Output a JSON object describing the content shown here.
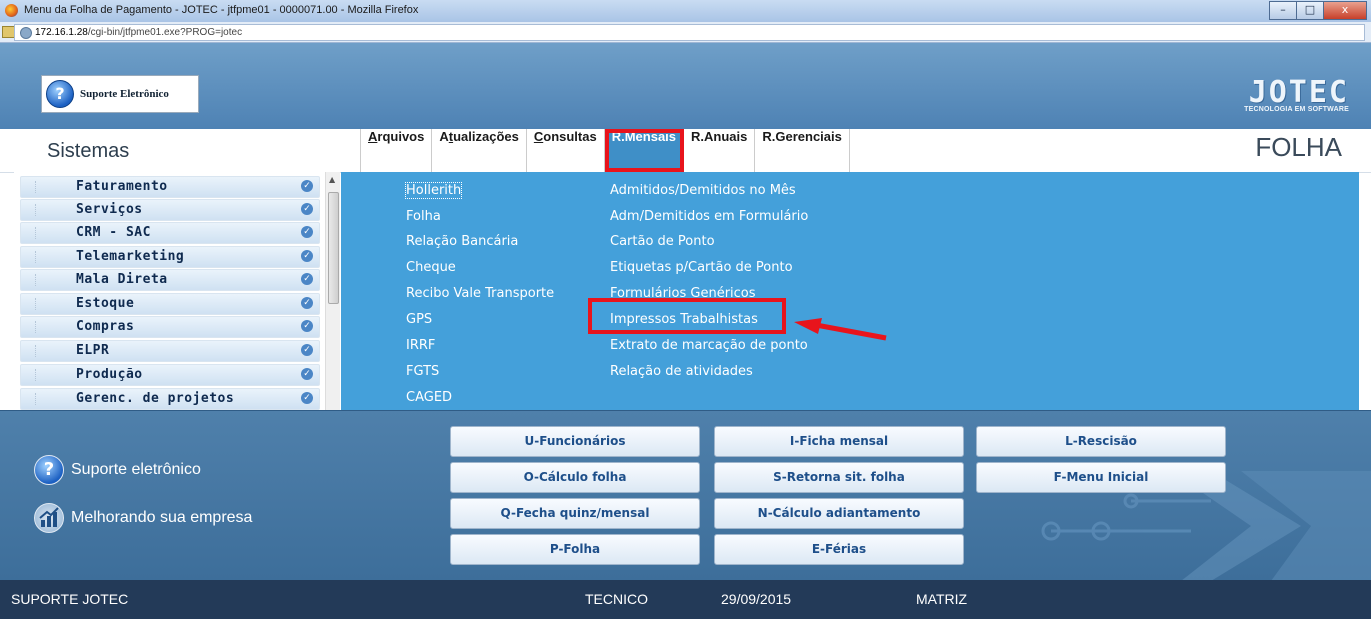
{
  "window": {
    "title": "Menu da Folha de Pagamento - JOTEC - jtfpme01 - 0000071.00 - Mozilla Firefox",
    "minimize": "–",
    "maximize": "□",
    "close": "x",
    "url_host": "172.16.1.28",
    "url_path": "/cgi-bin/jtfpme01.exe?PROG=jotec"
  },
  "header": {
    "support_label": "Suporte Eletrônico",
    "logo_main": "JOTEC",
    "logo_sub": "TECNOLOGIA EM SOFTWARE"
  },
  "menubar": {
    "sistemas": "Sistemas",
    "items": [
      {
        "underline": "A",
        "rest": "rquivos"
      },
      {
        "pre": "A",
        "underline": "t",
        "rest": "ualizações"
      },
      {
        "underline": "C",
        "rest": "onsultas"
      },
      {
        "label": "R.Mensais"
      },
      {
        "label": "R.Anuais"
      },
      {
        "label": "R.Gerenciais"
      }
    ],
    "module_title": "FOLHA"
  },
  "sidebar": {
    "items": [
      "Faturamento",
      "Serviços",
      "CRM - SAC",
      "Telemarketing",
      "Mala Direta",
      "Estoque",
      "Compras",
      "ELPR",
      "Produção",
      "Gerenc. de projetos"
    ],
    "check": "✓",
    "scroll_up": "▲"
  },
  "dropdown": {
    "col1": [
      "Hollerith",
      "Folha",
      "Relação Bancária",
      "Cheque",
      "Recibo Vale Transporte",
      "GPS",
      "IRRF",
      "FGTS",
      "CAGED"
    ],
    "col2": [
      "Admitidos/Demitidos no Mês",
      "Adm/Demitidos em Formulário",
      "Cartão de Ponto",
      "Etiquetas p/Cartão de Ponto",
      "Formulários Genéricos",
      "Impressos Trabalhistas",
      "Extrato de marcação de ponto",
      "Relação de atividades"
    ]
  },
  "bottom": {
    "support_link": "Suporte eletrônico",
    "improve_link": "Melhorando sua empresa",
    "q_glyph": "?",
    "buttons": [
      "U-Funcionários",
      "I-Ficha mensal",
      "L-Rescisão",
      "O-Cálculo folha",
      "S-Retorna sit. folha",
      "F-Menu Inicial",
      "Q-Fecha quinz/mensal",
      "N-Cálculo adiantamento",
      "P-Folha",
      "E-Férias"
    ]
  },
  "status": {
    "user": "SUPORTE JOTEC",
    "role": "TECNICO",
    "date": "29/09/2015",
    "branch": "MATRIZ"
  },
  "colors": {
    "accent": "#44a0da",
    "highlight_border": "#e8141c",
    "status_bg": "#233a58"
  }
}
